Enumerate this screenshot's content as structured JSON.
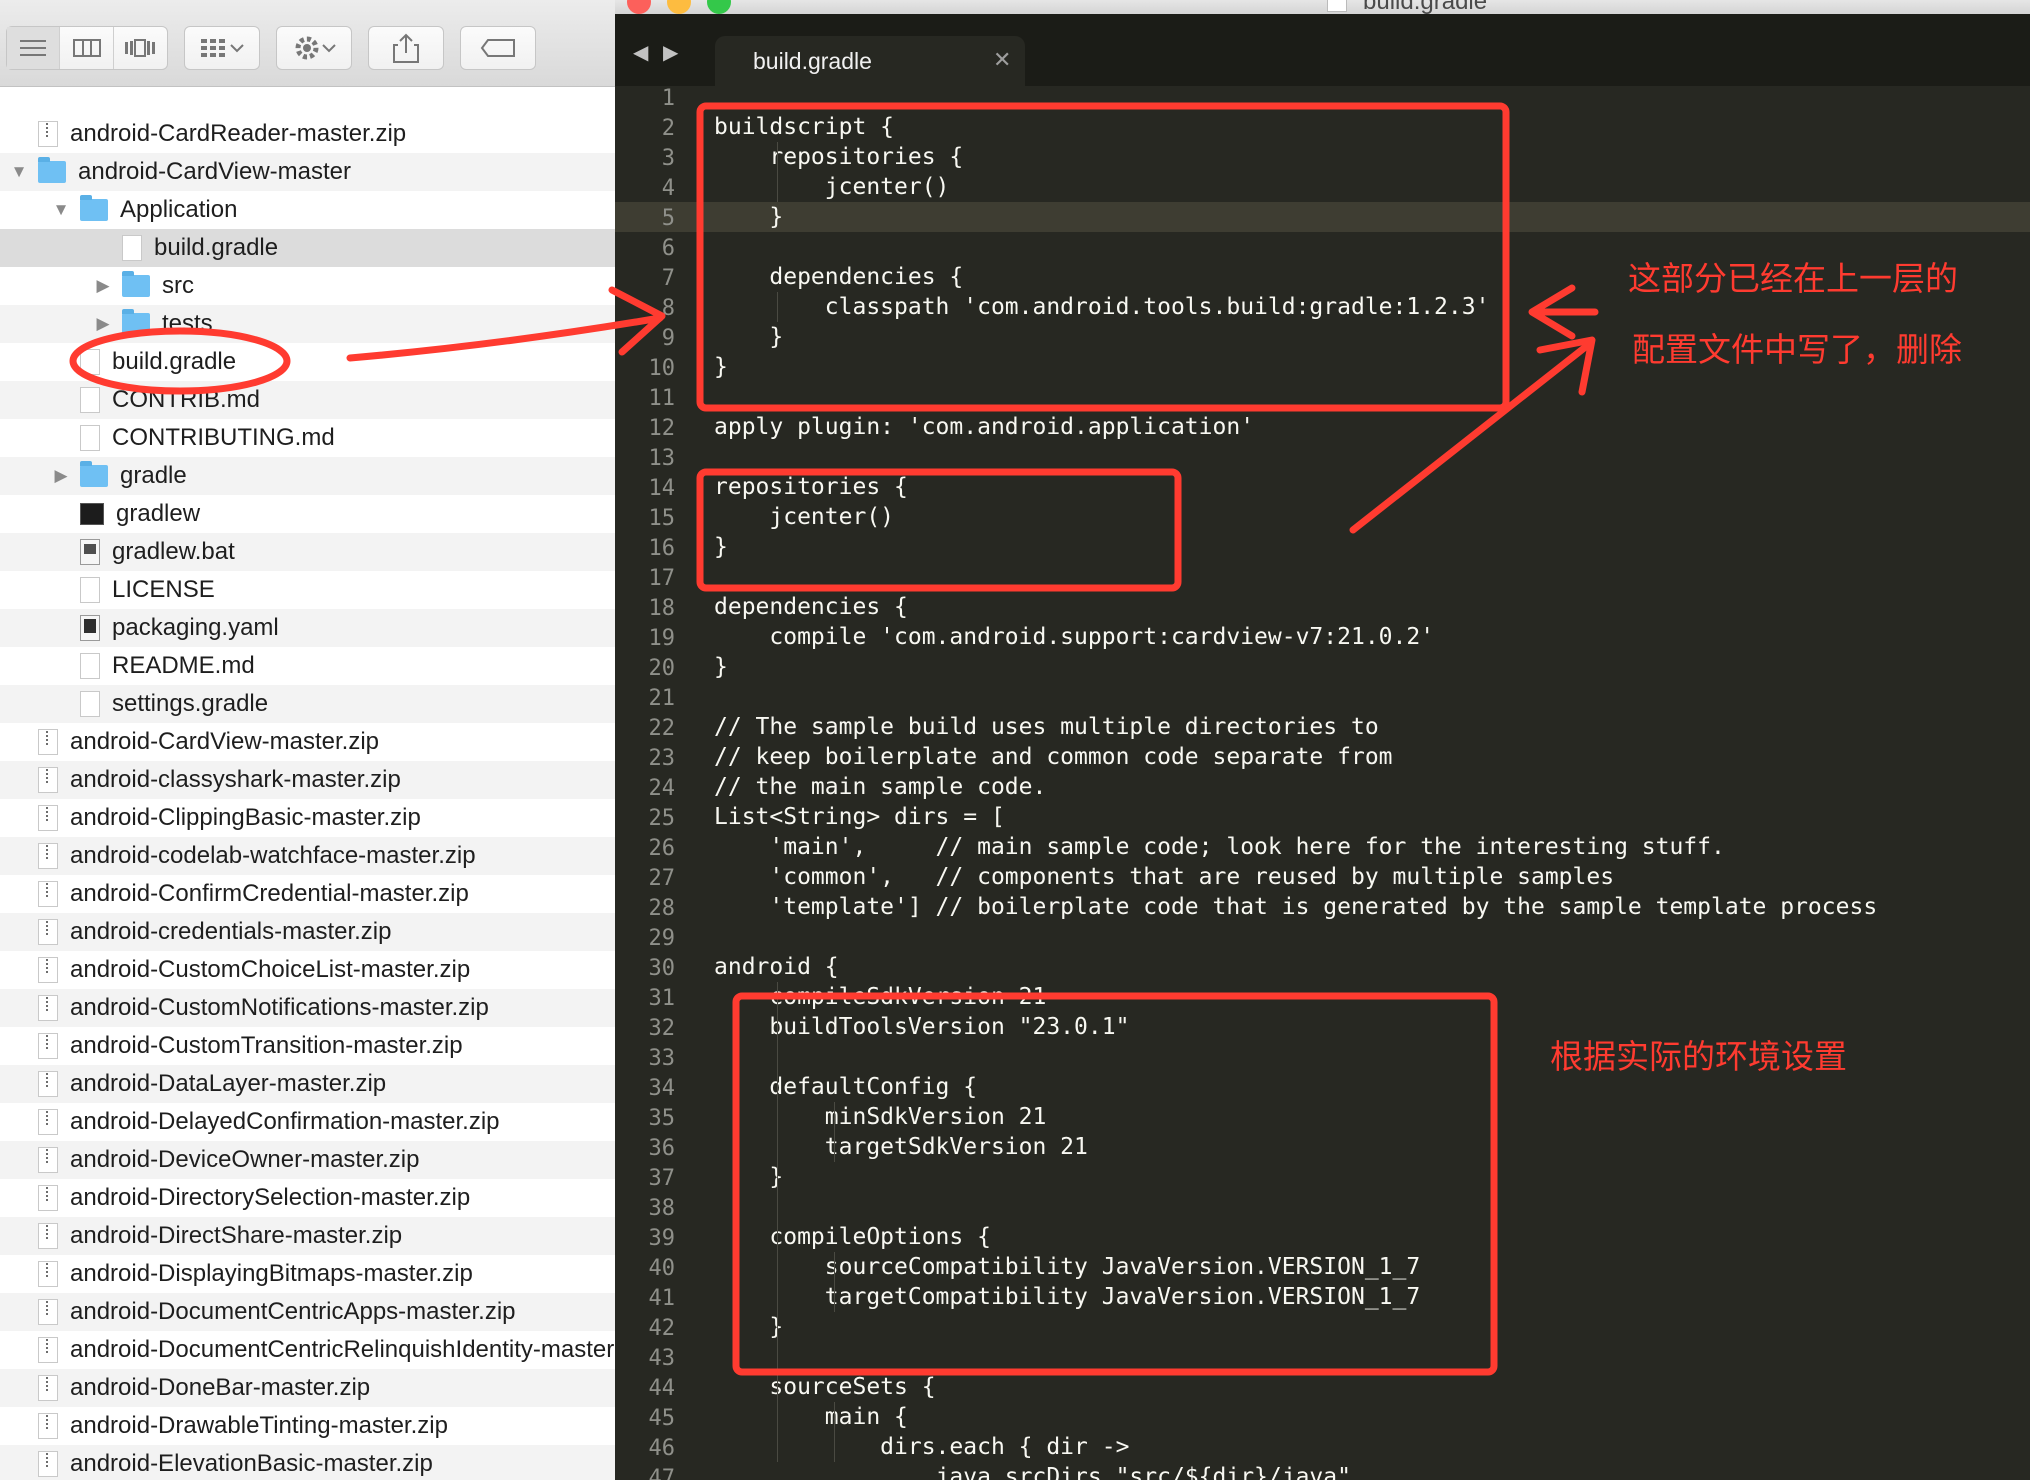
{
  "finder": {
    "rows": [
      {
        "name": "android-CardReader-master.zip",
        "depth": 0,
        "disclosure": "none",
        "icon": "zip",
        "shade": "none"
      },
      {
        "name": "android-CardView-master",
        "depth": 0,
        "disclosure": "down",
        "icon": "folder",
        "shade": "alt"
      },
      {
        "name": "Application",
        "depth": 1,
        "disclosure": "down",
        "icon": "folder",
        "shade": "none"
      },
      {
        "name": "build.gradle",
        "depth": 2,
        "disclosure": "none",
        "icon": "doc",
        "shade": "sel"
      },
      {
        "name": "src",
        "depth": 2,
        "disclosure": "right",
        "icon": "folder",
        "shade": "none"
      },
      {
        "name": "tests",
        "depth": 2,
        "disclosure": "right",
        "icon": "folder",
        "shade": "alt"
      },
      {
        "name": "build.gradle",
        "depth": 1,
        "disclosure": "none",
        "icon": "doc",
        "shade": "none"
      },
      {
        "name": "CONTRIB.md",
        "depth": 1,
        "disclosure": "none",
        "icon": "doc",
        "shade": "alt"
      },
      {
        "name": "CONTRIBUTING.md",
        "depth": 1,
        "disclosure": "none",
        "icon": "doc",
        "shade": "none"
      },
      {
        "name": "gradle",
        "depth": 1,
        "disclosure": "right",
        "icon": "folder",
        "shade": "alt"
      },
      {
        "name": "gradlew",
        "depth": 1,
        "disclosure": "none",
        "icon": "exec",
        "shade": "none"
      },
      {
        "name": "gradlew.bat",
        "depth": 1,
        "disclosure": "none",
        "icon": "bat",
        "shade": "alt"
      },
      {
        "name": "LICENSE",
        "depth": 1,
        "disclosure": "none",
        "icon": "doc",
        "shade": "none"
      },
      {
        "name": "packaging.yaml",
        "depth": 1,
        "disclosure": "none",
        "icon": "yaml",
        "shade": "alt"
      },
      {
        "name": "README.md",
        "depth": 1,
        "disclosure": "none",
        "icon": "doc",
        "shade": "none"
      },
      {
        "name": "settings.gradle",
        "depth": 1,
        "disclosure": "none",
        "icon": "doc",
        "shade": "alt"
      },
      {
        "name": "android-CardView-master.zip",
        "depth": 0,
        "disclosure": "none",
        "icon": "zip",
        "shade": "none"
      },
      {
        "name": "android-classyshark-master.zip",
        "depth": 0,
        "disclosure": "none",
        "icon": "zip",
        "shade": "alt"
      },
      {
        "name": "android-ClippingBasic-master.zip",
        "depth": 0,
        "disclosure": "none",
        "icon": "zip",
        "shade": "none"
      },
      {
        "name": "android-codelab-watchface-master.zip",
        "depth": 0,
        "disclosure": "none",
        "icon": "zip",
        "shade": "alt"
      },
      {
        "name": "android-ConfirmCredential-master.zip",
        "depth": 0,
        "disclosure": "none",
        "icon": "zip",
        "shade": "none"
      },
      {
        "name": "android-credentials-master.zip",
        "depth": 0,
        "disclosure": "none",
        "icon": "zip",
        "shade": "alt"
      },
      {
        "name": "android-CustomChoiceList-master.zip",
        "depth": 0,
        "disclosure": "none",
        "icon": "zip",
        "shade": "none"
      },
      {
        "name": "android-CustomNotifications-master.zip",
        "depth": 0,
        "disclosure": "none",
        "icon": "zip",
        "shade": "alt"
      },
      {
        "name": "android-CustomTransition-master.zip",
        "depth": 0,
        "disclosure": "none",
        "icon": "zip",
        "shade": "none"
      },
      {
        "name": "android-DataLayer-master.zip",
        "depth": 0,
        "disclosure": "none",
        "icon": "zip",
        "shade": "alt"
      },
      {
        "name": "android-DelayedConfirmation-master.zip",
        "depth": 0,
        "disclosure": "none",
        "icon": "zip",
        "shade": "none"
      },
      {
        "name": "android-DeviceOwner-master.zip",
        "depth": 0,
        "disclosure": "none",
        "icon": "zip",
        "shade": "alt"
      },
      {
        "name": "android-DirectorySelection-master.zip",
        "depth": 0,
        "disclosure": "none",
        "icon": "zip",
        "shade": "none"
      },
      {
        "name": "android-DirectShare-master.zip",
        "depth": 0,
        "disclosure": "none",
        "icon": "zip",
        "shade": "alt"
      },
      {
        "name": "android-DisplayingBitmaps-master.zip",
        "depth": 0,
        "disclosure": "none",
        "icon": "zip",
        "shade": "none"
      },
      {
        "name": "android-DocumentCentricApps-master.zip",
        "depth": 0,
        "disclosure": "none",
        "icon": "zip",
        "shade": "alt"
      },
      {
        "name": "android-DocumentCentricRelinquishIdentity-master.zip",
        "depth": 0,
        "disclosure": "none",
        "icon": "zip",
        "shade": "none"
      },
      {
        "name": "android-DoneBar-master.zip",
        "depth": 0,
        "disclosure": "none",
        "icon": "zip",
        "shade": "alt"
      },
      {
        "name": "android-DrawableTinting-master.zip",
        "depth": 0,
        "disclosure": "none",
        "icon": "zip",
        "shade": "none"
      },
      {
        "name": "android-ElevationBasic-master.zip",
        "depth": 0,
        "disclosure": "none",
        "icon": "zip",
        "shade": "alt"
      }
    ]
  },
  "editor": {
    "window_title": "build.gradle",
    "tab_label": "build.gradle",
    "tab_close": "✕",
    "current_line": 5,
    "first_line": 1,
    "lines": [
      "",
      "buildscript {",
      "    repositories {",
      "        jcenter()",
      "    }",
      "",
      "    dependencies {",
      "        classpath 'com.android.tools.build:gradle:1.2.3'",
      "    }",
      "}",
      "",
      "apply plugin: 'com.android.application'",
      "",
      "repositories {",
      "    jcenter()",
      "}",
      "",
      "dependencies {",
      "    compile 'com.android.support:cardview-v7:21.0.2'",
      "}",
      "",
      "// The sample build uses multiple directories to",
      "// keep boilerplate and common code separate from",
      "// the main sample code.",
      "List<String> dirs = [",
      "    'main',     // main sample code; look here for the interesting stuff.",
      "    'common',   // components that are reused by multiple samples",
      "    'template'] // boilerplate code that is generated by the sample template process",
      "",
      "android {",
      "    compileSdkVersion 21",
      "    buildToolsVersion \"23.0.1\"",
      "",
      "    defaultConfig {",
      "        minSdkVersion 21",
      "        targetSdkVersion 21",
      "    }",
      "",
      "    compileOptions {",
      "        sourceCompatibility JavaVersion.VERSION_1_7",
      "        targetCompatibility JavaVersion.VERSION_1_7",
      "    }",
      "",
      "    sourceSets {",
      "        main {",
      "            dirs.each { dir ->",
      "                java.srcDirs \"src/${dir}/java\""
    ]
  },
  "annotations": {
    "note_delete_line1": "这部分已经在上一层的",
    "note_delete_line2": "配置文件中写了，删除",
    "note_env": "根据实际的环境设置",
    "color": "#ff3b30"
  }
}
